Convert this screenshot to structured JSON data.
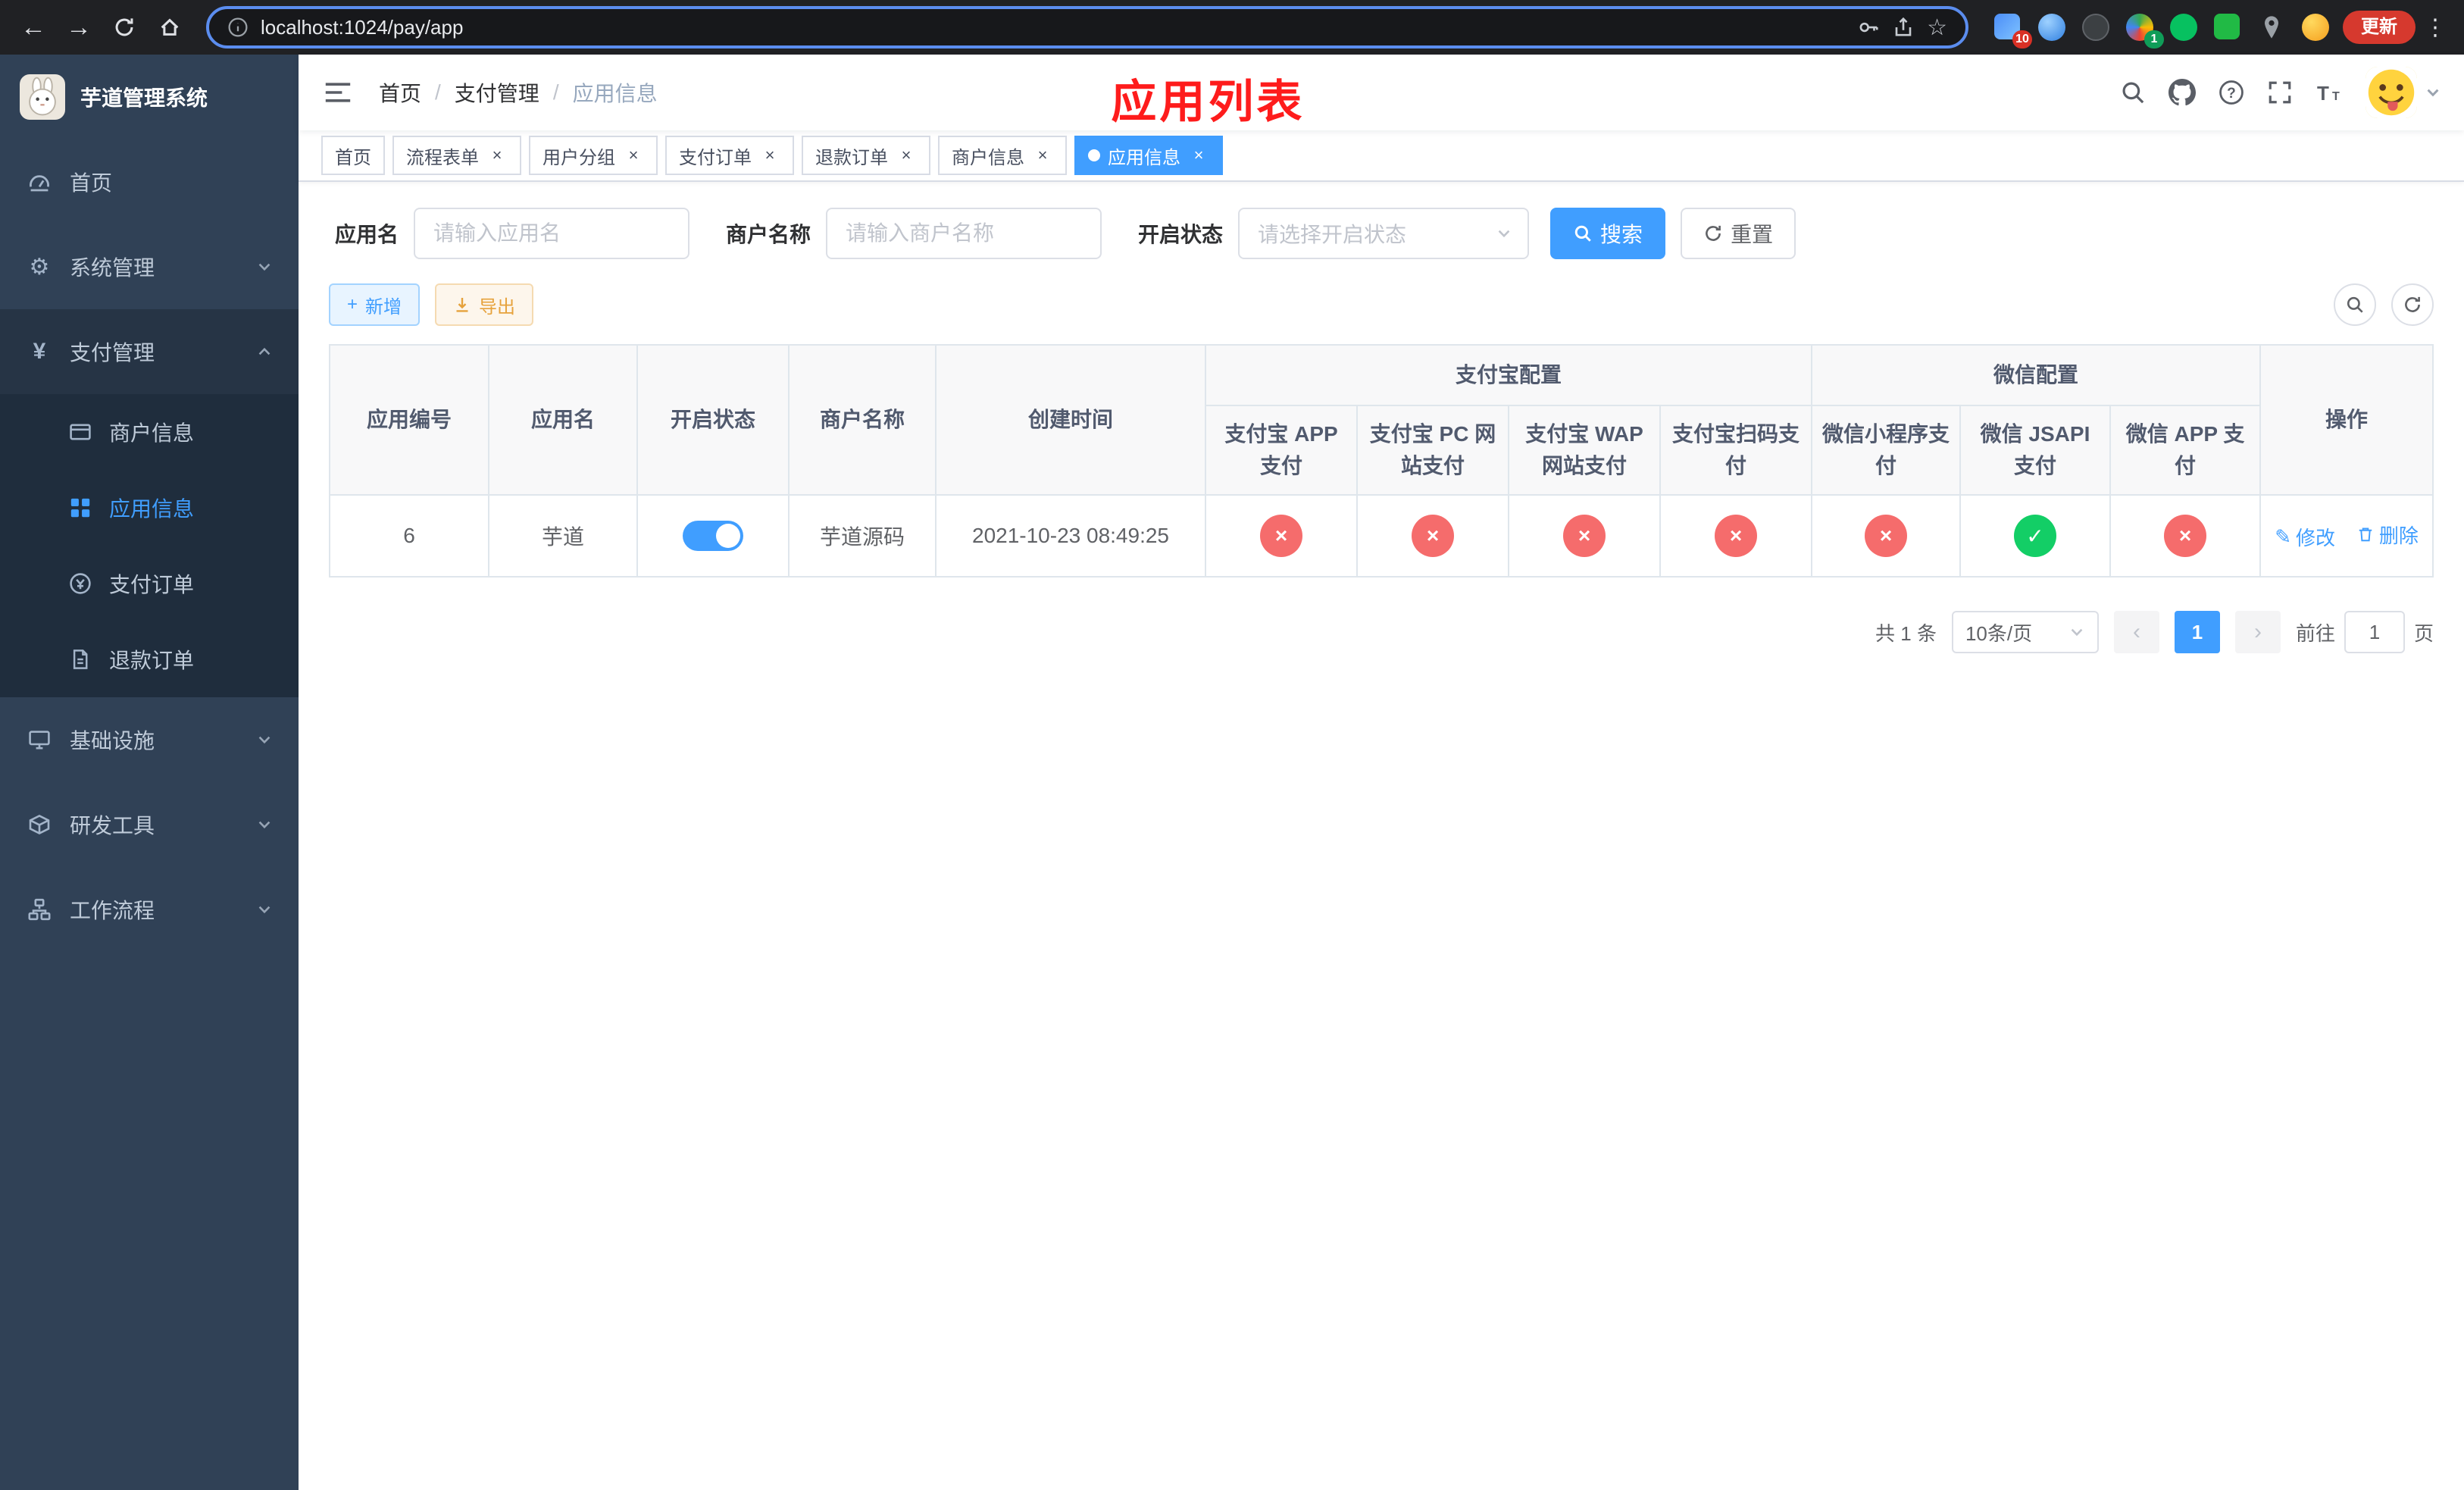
{
  "colors": {
    "accent": "#409eff",
    "danger": "#f56c6c",
    "success": "#13ce66",
    "warning": "#e6a23c",
    "sidebar-bg": "#304156",
    "submenu-bg": "#1f2d3d",
    "annotation": "#fe1c1c",
    "update-red": "#d6392e"
  },
  "browser": {
    "url": "localhost:1024/pay/app",
    "update_button": "更新",
    "ext_badge_puzzle": "10",
    "ext_badge_colorful": "1"
  },
  "sidebar": {
    "logo_title": "芋道管理系统",
    "items": {
      "home": "首页",
      "system": "系统管理",
      "payment": "支付管理",
      "infra": "基础设施",
      "devtools": "研发工具",
      "workflow": "工作流程"
    },
    "payment_children": {
      "merchant": "商户信息",
      "app": "应用信息",
      "order": "支付订单",
      "refund": "退款订单"
    }
  },
  "header": {
    "breadcrumb": [
      "首页",
      "支付管理",
      "应用信息"
    ],
    "separator": "/",
    "annotation": "应用列表"
  },
  "tags": [
    {
      "label": "首页"
    },
    {
      "label": "流程表单"
    },
    {
      "label": "用户分组"
    },
    {
      "label": "支付订单"
    },
    {
      "label": "退款订单"
    },
    {
      "label": "商户信息"
    },
    {
      "label": "应用信息"
    }
  ],
  "filters": {
    "app_name_label": "应用名",
    "app_name_placeholder": "请输入应用名",
    "merchant_label": "商户名称",
    "merchant_placeholder": "请输入商户名称",
    "status_label": "开启状态",
    "status_placeholder": "请选择开启状态",
    "search_button": "搜索",
    "reset_button": "重置"
  },
  "toolbar": {
    "add_button": "新增",
    "export_button": "导出"
  },
  "table": {
    "headers": {
      "app_id": "应用编号",
      "app_name": "应用名",
      "status": "开启状态",
      "merchant": "商户名称",
      "created": "创建时间",
      "alipay_group": "支付宝配置",
      "wechat_group": "微信配置",
      "alipay_app": "支付宝 APP 支付",
      "alipay_pc": "支付宝 PC 网站支付",
      "alipay_wap": "支付宝 WAP 网站支付",
      "alipay_qr": "支付宝扫码支付",
      "wx_mini": "微信小程序支付",
      "wx_jsapi": "微信 JSAPI 支付",
      "wx_app": "微信 APP 支付",
      "actions": "操作"
    },
    "row": {
      "app_id": "6",
      "app_name": "芋道",
      "status_on": true,
      "merchant": "芋道源码",
      "created": "2021-10-23 08:49:25",
      "configs": [
        "x",
        "x",
        "x",
        "x",
        "x",
        "check",
        "x"
      ],
      "edit": "修改",
      "delete": "删除"
    }
  },
  "pagination": {
    "total": "共 1 条",
    "page_size": "10条/页",
    "page": "1",
    "goto_label": "前往",
    "goto_value": "1",
    "goto_suffix": "页"
  },
  "icons": {
    "back": "←",
    "forward": "→",
    "star": "☆",
    "gear": "⚙",
    "yen": "¥",
    "edit": "✎",
    "kebab": "⋮"
  }
}
